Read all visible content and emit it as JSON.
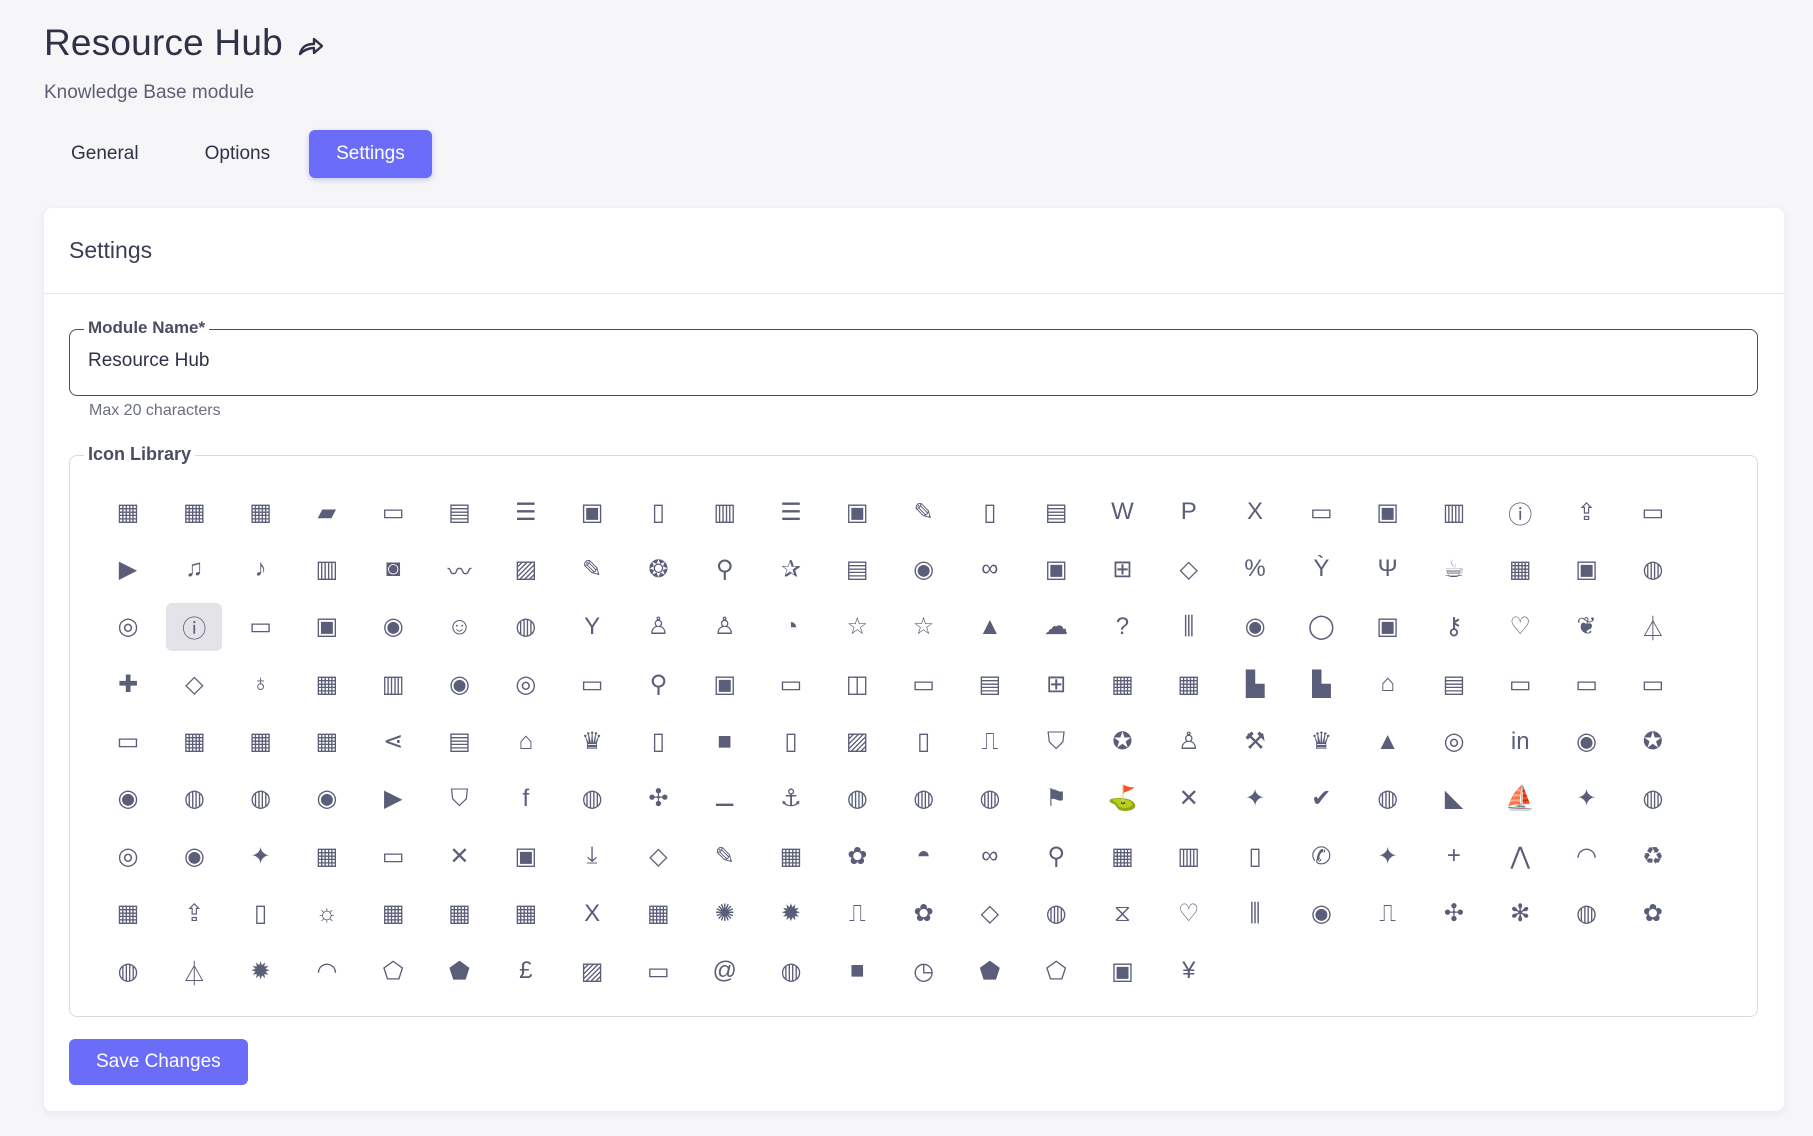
{
  "header": {
    "title": "Resource Hub",
    "subtitle": "Knowledge Base module",
    "share_icon": "share-arrow-icon"
  },
  "tabs": [
    {
      "label": "General",
      "active": false
    },
    {
      "label": "Options",
      "active": false
    },
    {
      "label": "Settings",
      "active": true
    }
  ],
  "card": {
    "title": "Settings",
    "module_name": {
      "label": "Module Name*",
      "value": "Resource Hub",
      "helper": "Max 20 characters"
    },
    "icon_library": {
      "label": "Icon Library",
      "selected_index": 49,
      "icons": [
        [
          "calendar",
          "▦"
        ],
        [
          "calendar-check",
          "▦"
        ],
        [
          "calendar-event",
          "▦"
        ],
        [
          "book",
          "▰"
        ],
        [
          "notebook",
          "▭"
        ],
        [
          "book-open",
          "▤"
        ],
        [
          "file-text",
          "☰"
        ],
        [
          "contact",
          "▣"
        ],
        [
          "file",
          "▯"
        ],
        [
          "file-chart",
          "▥"
        ],
        [
          "file-lines",
          "☰"
        ],
        [
          "file-lock",
          "▣"
        ],
        [
          "file-edit",
          "✎"
        ],
        [
          "notebook-spiral",
          "▯"
        ],
        [
          "clipboard",
          "▤"
        ],
        [
          "file-word",
          "W"
        ],
        [
          "file-powerpoint",
          "P"
        ],
        [
          "file-excel",
          "X"
        ],
        [
          "folder",
          "▭"
        ],
        [
          "folder-user",
          "▣"
        ],
        [
          "folder-chart",
          "▥"
        ],
        [
          "folder-info",
          "ⓘ"
        ],
        [
          "folder-upload",
          "⇪"
        ],
        [
          "folder-open",
          "▭"
        ],
        [
          "play",
          "▶"
        ],
        [
          "music",
          "♫"
        ],
        [
          "file-music",
          "♪"
        ],
        [
          "film",
          "▥"
        ],
        [
          "camera",
          "◙"
        ],
        [
          "waveform",
          "〰"
        ],
        [
          "image",
          "▨"
        ],
        [
          "pencil",
          "✎"
        ],
        [
          "award",
          "❂"
        ],
        [
          "search-user",
          "⚲"
        ],
        [
          "running",
          "✰"
        ],
        [
          "ticket",
          "▤"
        ],
        [
          "whistle",
          "◉"
        ],
        [
          "link",
          "∞"
        ],
        [
          "shopping-bag",
          "▣"
        ],
        [
          "cart",
          "⊞"
        ],
        [
          "tag",
          "◇"
        ],
        [
          "percent",
          "%"
        ],
        [
          "cocktail",
          "Ỳ"
        ],
        [
          "utensils",
          "Ψ"
        ],
        [
          "coffee",
          "☕"
        ],
        [
          "cake",
          "▦"
        ],
        [
          "gift",
          "▣"
        ],
        [
          "globe",
          "◍"
        ],
        [
          "globe-alt",
          "◎"
        ],
        [
          "info",
          "ⓘ"
        ],
        [
          "ticket-alt",
          "▭"
        ],
        [
          "wallet",
          "▣"
        ],
        [
          "user-circle",
          "◉"
        ],
        [
          "emoji",
          "☺"
        ],
        [
          "palette",
          "◍"
        ],
        [
          "celebrate",
          "Y"
        ],
        [
          "user",
          "♙"
        ],
        [
          "users",
          "♙"
        ],
        [
          "idea-head",
          "◔"
        ],
        [
          "star-badge",
          "☆"
        ],
        [
          "star",
          "☆"
        ],
        [
          "graduation",
          "▲"
        ],
        [
          "cloud",
          "☁"
        ],
        [
          "help",
          "?"
        ],
        [
          "bars",
          "⫼"
        ],
        [
          "broadcast",
          "◉"
        ],
        [
          "bulb",
          "◯"
        ],
        [
          "safe",
          "▣"
        ],
        [
          "key",
          "⚷"
        ],
        [
          "heart",
          "♡"
        ],
        [
          "sprout",
          "❦"
        ],
        [
          "flask",
          "⏃"
        ],
        [
          "first-aid",
          "✚"
        ],
        [
          "donate",
          "◇"
        ],
        [
          "stethoscope",
          "♁"
        ],
        [
          "hospital",
          "▦"
        ],
        [
          "map",
          "▥"
        ],
        [
          "map-pin",
          "◉"
        ],
        [
          "map-location",
          "◎"
        ],
        [
          "car",
          "▭"
        ],
        [
          "bicycle",
          "⚲"
        ],
        [
          "train",
          "▣"
        ],
        [
          "truck",
          "▭"
        ],
        [
          "ship",
          "◫"
        ],
        [
          "shop",
          "▭"
        ],
        [
          "store",
          "▤"
        ],
        [
          "bank",
          "⊞"
        ],
        [
          "building",
          "▦"
        ],
        [
          "office",
          "▦"
        ],
        [
          "factory",
          "▙"
        ],
        [
          "warehouse",
          "▙"
        ],
        [
          "home",
          "⌂"
        ],
        [
          "cabinet",
          "▤"
        ],
        [
          "archive",
          "▭"
        ],
        [
          "monitor",
          "▭"
        ],
        [
          "ticket-star",
          "▭"
        ],
        [
          "folder-alt",
          "▭"
        ],
        [
          "grid",
          "▦"
        ],
        [
          "calendar-note",
          "▦"
        ],
        [
          "table",
          "▦"
        ],
        [
          "share-nodes",
          "⋖"
        ],
        [
          "newspaper",
          "▤"
        ],
        [
          "bell",
          "⌂"
        ],
        [
          "trophy",
          "♛"
        ],
        [
          "note",
          "▯"
        ],
        [
          "folder-solid",
          "■"
        ],
        [
          "file-gif",
          "▯"
        ],
        [
          "image-file",
          "▨"
        ],
        [
          "file-pdf",
          "▯"
        ],
        [
          "microphone",
          "⎍"
        ],
        [
          "shield",
          "⛉"
        ],
        [
          "medal",
          "✪"
        ],
        [
          "teacher",
          "♙"
        ],
        [
          "cricket",
          "⚒"
        ],
        [
          "crown",
          "♛"
        ],
        [
          "drive",
          "▲"
        ],
        [
          "instagram",
          "◎"
        ],
        [
          "linkedin",
          "in"
        ],
        [
          "live",
          "◉"
        ],
        [
          "ribbon",
          "✪"
        ],
        [
          "messenger",
          "◉"
        ],
        [
          "cookie",
          "◍"
        ],
        [
          "ping-pong",
          "◍"
        ],
        [
          "radio-waves",
          "◉"
        ],
        [
          "youtube",
          "▶"
        ],
        [
          "shield-check",
          "⛉"
        ],
        [
          "facebook",
          "f"
        ],
        [
          "football",
          "◍"
        ],
        [
          "pinwheel",
          "✣"
        ],
        [
          "dumbbell",
          "⚊"
        ],
        [
          "anchor",
          "⚓"
        ],
        [
          "basketball",
          "◍"
        ],
        [
          "tennis",
          "◍"
        ],
        [
          "gamepad",
          "◍"
        ],
        [
          "golf-flag",
          "⚑"
        ],
        [
          "golfer",
          "⛳"
        ],
        [
          "hockey",
          "✕"
        ],
        [
          "shuttle",
          "✦"
        ],
        [
          "check",
          "✔"
        ],
        [
          "rugby",
          "◍"
        ],
        [
          "skate",
          "◣"
        ],
        [
          "sailboat",
          "⛵"
        ],
        [
          "badminton",
          "✦"
        ],
        [
          "soccer",
          "◍"
        ],
        [
          "target",
          "◎"
        ],
        [
          "eye",
          "◉"
        ],
        [
          "sparkles",
          "✦"
        ],
        [
          "dashboard",
          "▦"
        ],
        [
          "comment-dots",
          "▭"
        ],
        [
          "close",
          "✕"
        ],
        [
          "tablet",
          "▣"
        ],
        [
          "download",
          "⤓"
        ],
        [
          "droplet",
          "◇"
        ],
        [
          "feather",
          "✎"
        ],
        [
          "fri",
          "▦"
        ],
        [
          "group",
          "✿"
        ],
        [
          "thumbs-up",
          "◓"
        ],
        [
          "infinity",
          "∞"
        ],
        [
          "magnifier",
          "⚲"
        ],
        [
          "mon",
          "▦"
        ],
        [
          "book-open-alt",
          "▥"
        ],
        [
          "pdf",
          "▯"
        ],
        [
          "phone",
          "✆"
        ],
        [
          "dove",
          "✦"
        ],
        [
          "plus",
          "+"
        ],
        [
          "pray",
          "⋀"
        ],
        [
          "rainbow",
          "◠"
        ],
        [
          "recycle",
          "♻"
        ],
        [
          "sat",
          "▦"
        ],
        [
          "upload",
          "⇪"
        ],
        [
          "smartphone",
          "▯"
        ],
        [
          "sun",
          "☼"
        ],
        [
          "sun-day",
          "▦"
        ],
        [
          "thu",
          "▦"
        ],
        [
          "tue",
          "▦"
        ],
        [
          "x-logo",
          "X"
        ],
        [
          "wed",
          "▦"
        ],
        [
          "bacteria",
          "✺"
        ],
        [
          "virus",
          "✹"
        ],
        [
          "test-tube",
          "⎍"
        ],
        [
          "brain",
          "✿"
        ],
        [
          "ribbon-awareness",
          "◇"
        ],
        [
          "kidney",
          "◍"
        ],
        [
          "dna",
          "⧖"
        ],
        [
          "hands-heart",
          "♡"
        ],
        [
          "people",
          "⫼"
        ],
        [
          "hospital-sign",
          "◉"
        ],
        [
          "microscope",
          "⎍"
        ],
        [
          "molecule",
          "✣"
        ],
        [
          "snowflake",
          "✻"
        ],
        [
          "pill",
          "◍"
        ],
        [
          "cells",
          "✿"
        ],
        [
          "speed",
          "◍"
        ],
        [
          "beaker",
          "⏃"
        ],
        [
          "settings-sun",
          "✹"
        ],
        [
          "wifi",
          "◠"
        ],
        [
          "ntc",
          "⬠"
        ],
        [
          "ntc-solid",
          "⬟"
        ],
        [
          "pound",
          "£"
        ],
        [
          "no-image",
          "▨"
        ],
        [
          "tv",
          "▭"
        ],
        [
          "at",
          "@"
        ],
        [
          "leaf",
          "◍"
        ],
        [
          "square",
          "■"
        ],
        [
          "clock-plus",
          "◷"
        ],
        [
          "wc-solid",
          "⬟"
        ],
        [
          "wc",
          "⬠"
        ],
        [
          "inbox-download",
          "▣"
        ],
        [
          "yen",
          "¥"
        ]
      ]
    },
    "save_label": "Save Changes"
  }
}
